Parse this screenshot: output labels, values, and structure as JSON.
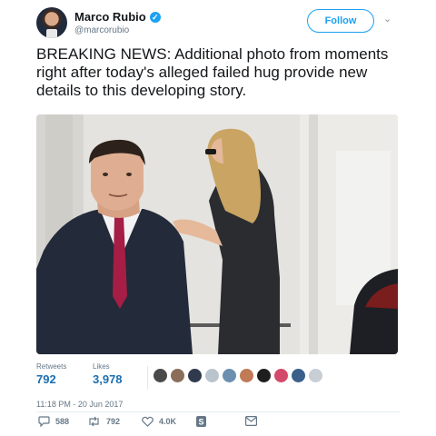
{
  "author": {
    "name": "Marco Rubio",
    "handle": "@marcorubio",
    "verified_icon": "verified-badge-icon",
    "follow_label": "Follow"
  },
  "tweet": {
    "text": "BREAKING NEWS: Additional photo from moments right after today's alleged failed hug provide new details to this developing story."
  },
  "stats": {
    "retweets_label": "Retweets",
    "retweets_value": "792",
    "likes_label": "Likes",
    "likes_value": "3,978",
    "liker_colors": [
      "#4a4a4a",
      "#8a6e5a",
      "#2f3b4c",
      "#b9c4cc",
      "#6c8fb0",
      "#c07a55",
      "#1e1e1e",
      "#d34a6a",
      "#3a5f8a",
      "#c7ced4"
    ]
  },
  "timestamp": "11:18 PM - 20 Jun 2017",
  "actions": {
    "replies": "588",
    "retweets": "792",
    "likes": "4.0K",
    "reply_icon": "reply-icon",
    "retweet_icon": "retweet-icon",
    "like_icon": "heart-icon",
    "extra_icon": "s-badge-icon",
    "dm_icon": "envelope-icon"
  },
  "colors": {
    "accent": "#1da1f2",
    "stat_value": "#1b6fb0",
    "muted": "#657786"
  }
}
